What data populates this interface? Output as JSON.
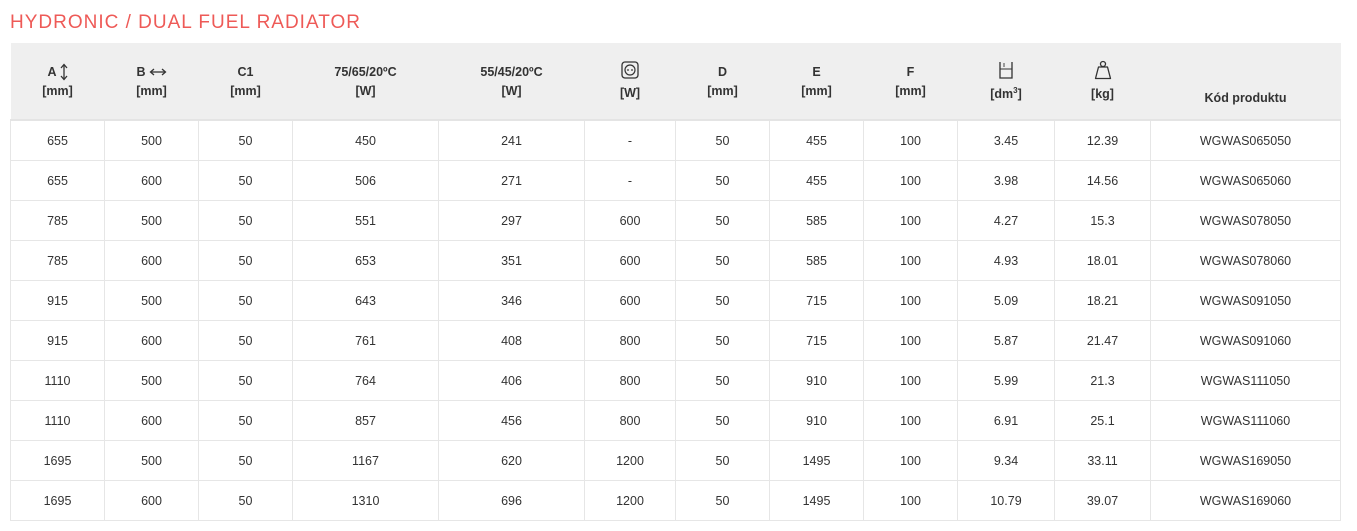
{
  "title": "HYDRONIC / DUAL FUEL RADIATOR",
  "icons": {
    "a": "vertical-arrow-icon",
    "b": "horizontal-arrow-icon",
    "socket": "electric-socket-icon",
    "volume": "water-container-icon",
    "weight": "weight-icon"
  },
  "headers": [
    {
      "label": "A",
      "unit": "[mm]"
    },
    {
      "label": "B",
      "unit": "[mm]"
    },
    {
      "label": "C1",
      "unit": "[mm]"
    },
    {
      "label": "75/65/20ºC",
      "unit": "[W]"
    },
    {
      "label": "55/45/20ºC",
      "unit": "[W]"
    },
    {
      "label": "",
      "unit": "[W]"
    },
    {
      "label": "D",
      "unit": "[mm]"
    },
    {
      "label": "E",
      "unit": "[mm]"
    },
    {
      "label": "F",
      "unit": "[mm]"
    },
    {
      "label": "",
      "unit": "[dm",
      "unit_sup": "3",
      "unit_end": "]"
    },
    {
      "label": "",
      "unit": "[kg]"
    },
    {
      "label": "",
      "unit": "Kód produktu"
    }
  ],
  "rows": [
    [
      "655",
      "500",
      "50",
      "450",
      "241",
      "-",
      "50",
      "455",
      "100",
      "3.45",
      "12.39",
      "WGWAS065050"
    ],
    [
      "655",
      "600",
      "50",
      "506",
      "271",
      "-",
      "50",
      "455",
      "100",
      "3.98",
      "14.56",
      "WGWAS065060"
    ],
    [
      "785",
      "500",
      "50",
      "551",
      "297",
      "600",
      "50",
      "585",
      "100",
      "4.27",
      "15.3",
      "WGWAS078050"
    ],
    [
      "785",
      "600",
      "50",
      "653",
      "351",
      "600",
      "50",
      "585",
      "100",
      "4.93",
      "18.01",
      "WGWAS078060"
    ],
    [
      "915",
      "500",
      "50",
      "643",
      "346",
      "600",
      "50",
      "715",
      "100",
      "5.09",
      "18.21",
      "WGWAS091050"
    ],
    [
      "915",
      "600",
      "50",
      "761",
      "408",
      "800",
      "50",
      "715",
      "100",
      "5.87",
      "21.47",
      "WGWAS091060"
    ],
    [
      "1110",
      "500",
      "50",
      "764",
      "406",
      "800",
      "50",
      "910",
      "100",
      "5.99",
      "21.3",
      "WGWAS111050"
    ],
    [
      "1110",
      "600",
      "50",
      "857",
      "456",
      "800",
      "50",
      "910",
      "100",
      "6.91",
      "25.1",
      "WGWAS111060"
    ],
    [
      "1695",
      "500",
      "50",
      "1167",
      "620",
      "1200",
      "50",
      "1495",
      "100",
      "9.34",
      "33.11",
      "WGWAS169050"
    ],
    [
      "1695",
      "600",
      "50",
      "1310",
      "696",
      "1200",
      "50",
      "1495",
      "100",
      "10.79",
      "39.07",
      "WGWAS169060"
    ]
  ]
}
